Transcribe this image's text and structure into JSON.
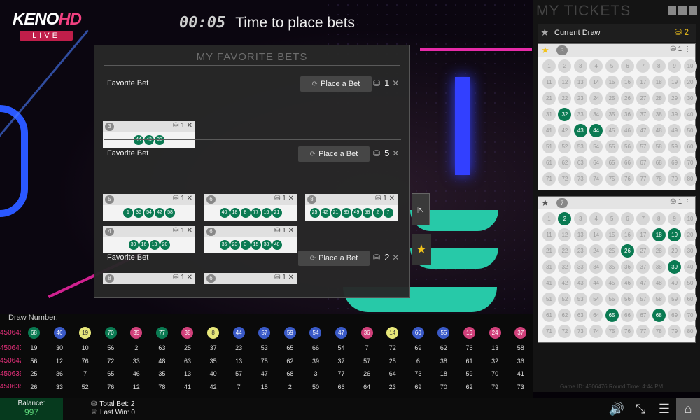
{
  "brand": {
    "keno": "KENO",
    "hd": "HD",
    "live": "LIVE"
  },
  "timer": {
    "time": "00:05",
    "message": "Time to place bets"
  },
  "favorites": {
    "title": "MY FAVORITE BETS",
    "sections": [
      {
        "label": "Favorite Bet",
        "button": "Place a Bet",
        "count": "1",
        "tickets": [
          {
            "n": "3",
            "count": "1",
            "balls": [
              "44",
              "43",
              "32"
            ]
          }
        ]
      },
      {
        "label": "Favorite Bet",
        "button": "Place a Bet",
        "count": "5",
        "tickets": [
          {
            "n": "5",
            "count": "1",
            "balls": [
              "1",
              "36",
              "54",
              "42",
              "58"
            ]
          },
          {
            "n": "6",
            "count": "1",
            "balls": [
              "40",
              "18",
              "8",
              "77",
              "16",
              "21"
            ]
          },
          {
            "n": "8",
            "count": "1",
            "balls": [
              "25",
              "42",
              "21",
              "35",
              "49",
              "58",
              "2",
              "7"
            ]
          },
          {
            "n": "4",
            "count": "1",
            "balls": [
              "39",
              "16",
              "13",
              "20"
            ]
          },
          {
            "n": "6",
            "count": "1",
            "balls": [
              "35",
              "23",
              "3",
              "15",
              "38",
              "48"
            ]
          }
        ]
      },
      {
        "label": "Favorite Bet",
        "button": "Place a Bet",
        "count": "2",
        "tickets": [
          {
            "n": "8",
            "count": "1",
            "balls": []
          },
          {
            "n": "6",
            "count": "1",
            "balls": []
          }
        ]
      }
    ]
  },
  "draws": {
    "label": "Draw Number:",
    "rows": [
      {
        "id": "4506457",
        "nums": [
          "68",
          "46",
          "19",
          "70",
          "35",
          "77",
          "38",
          "8",
          "44",
          "57",
          "59",
          "54",
          "47",
          "36",
          "14",
          "60",
          "55",
          "16",
          "24",
          "37"
        ]
      },
      {
        "id": "4506439",
        "nums": [
          "19",
          "30",
          "10",
          "56",
          "2",
          "63",
          "25",
          "37",
          "23",
          "53",
          "65",
          "66",
          "54",
          "7",
          "72",
          "69",
          "62",
          "76",
          "13",
          "58"
        ]
      },
      {
        "id": "4506421",
        "nums": [
          "56",
          "12",
          "76",
          "72",
          "33",
          "48",
          "63",
          "35",
          "13",
          "75",
          "62",
          "39",
          "37",
          "57",
          "25",
          "6",
          "38",
          "61",
          "32",
          "36"
        ]
      },
      {
        "id": "4506393",
        "nums": [
          "25",
          "36",
          "7",
          "65",
          "46",
          "35",
          "13",
          "40",
          "57",
          "47",
          "68",
          "3",
          "77",
          "26",
          "64",
          "73",
          "18",
          "59",
          "70",
          "41"
        ]
      },
      {
        "id": "4506359",
        "nums": [
          "26",
          "33",
          "52",
          "76",
          "12",
          "78",
          "41",
          "42",
          "7",
          "15",
          "2",
          "50",
          "66",
          "64",
          "23",
          "69",
          "70",
          "62",
          "79",
          "73"
        ]
      }
    ],
    "colors": [
      "#0a7a52",
      "#3a5ac8",
      "#e8e87a",
      "#0a7a52",
      "#d0407a",
      "#0a7a52",
      "#d0407a",
      "#e8e87a",
      "#3a5ac8",
      "#3a5ac8",
      "#3a5ac8",
      "#3a5ac8",
      "#3a5ac8",
      "#d0407a",
      "#e8e87a",
      "#3a5ac8",
      "#3a5ac8",
      "#d0407a",
      "#d0407a",
      "#d0407a"
    ]
  },
  "tickets": {
    "title": "MY TICKETS",
    "current_label": "Current Draw",
    "coin_count": "2",
    "cards": [
      {
        "n": "3",
        "count": "1",
        "hits": [
          32,
          43,
          44
        ],
        "starred": true
      },
      {
        "n": "7",
        "count": "1",
        "hits": [
          2,
          18,
          19,
          26,
          39,
          65,
          68
        ],
        "starred": false
      }
    ],
    "game_info": "Game ID: 4506476  Round Time: 4:44 PM"
  },
  "bottom": {
    "balance_label": "Balance:",
    "balance": "997",
    "total_bet": "Total Bet: 2",
    "last_win": "Last Win: 0"
  }
}
